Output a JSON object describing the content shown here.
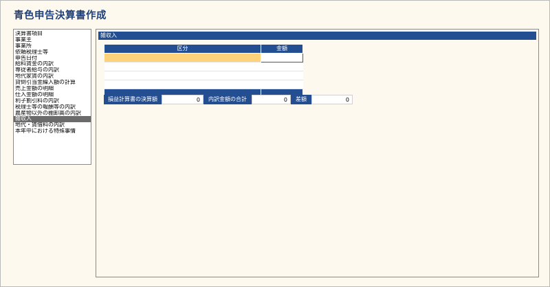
{
  "app": {
    "title": "青色申告決算書作成"
  },
  "sidebar": {
    "items": [
      {
        "label": "決算書項目",
        "selected": false
      },
      {
        "label": "事業主",
        "selected": false
      },
      {
        "label": "事業所",
        "selected": false
      },
      {
        "label": "依頼税理士等",
        "selected": false
      },
      {
        "label": "申告日付",
        "selected": false
      },
      {
        "label": "給料賃金の内訳",
        "selected": false
      },
      {
        "label": "専従者給与の内訳",
        "selected": false
      },
      {
        "label": "地代家賃の内訳",
        "selected": false
      },
      {
        "label": "貸倒引当金繰入額の計算",
        "selected": false
      },
      {
        "label": "売上金額の明細",
        "selected": false
      },
      {
        "label": "仕入金額の明細",
        "selected": false
      },
      {
        "label": "利子割引料の内訳",
        "selected": false
      },
      {
        "label": "税理士等の報酬等の内訳",
        "selected": false
      },
      {
        "label": "農産物以外の棚卸高の内訳",
        "selected": false
      },
      {
        "label": "雑収入",
        "selected": true
      },
      {
        "label": "地代・賃借料の内訳",
        "selected": false
      },
      {
        "label": "本年中における特殊事情",
        "selected": false
      }
    ]
  },
  "main": {
    "section_title": "雑収入",
    "table": {
      "headers": {
        "kubun": "区分",
        "kingaku": "金額"
      },
      "rows": [
        {
          "kubun": "",
          "kingaku": ""
        },
        {
          "kubun": "",
          "kingaku": ""
        },
        {
          "kubun": "",
          "kingaku": ""
        },
        {
          "kubun": "",
          "kingaku": ""
        }
      ]
    },
    "summary": {
      "pl_label": "損益計算書の決算額",
      "pl_value": "0",
      "breakdown_label": "内訳金額の合計",
      "breakdown_value": "0",
      "diff_label": "差額",
      "diff_value": "0"
    }
  },
  "colors": {
    "accent": "#234e91",
    "selected_row": "#fdd27a",
    "background": "#fdf9ef",
    "title": "#1e3f7a"
  }
}
